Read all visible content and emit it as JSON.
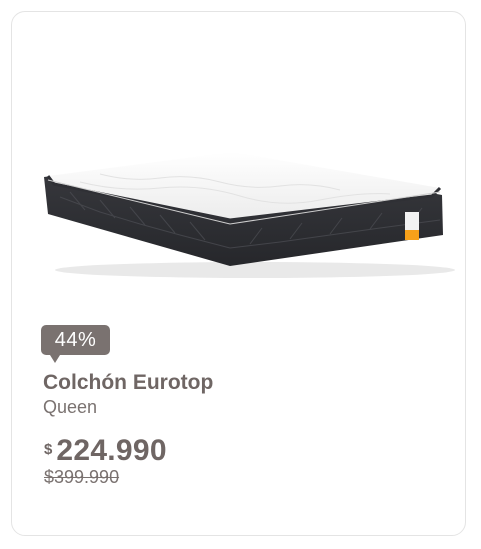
{
  "product": {
    "discount": "44%",
    "name": "Colchón Eurotop",
    "size": "Queen",
    "currency_symbol": "$",
    "price": "224.990",
    "old_price": "$399.990",
    "image": "mattress-image"
  },
  "colors": {
    "badge": "#7a7270",
    "text": "#6f6664",
    "card_border": "#e4e4e4"
  }
}
